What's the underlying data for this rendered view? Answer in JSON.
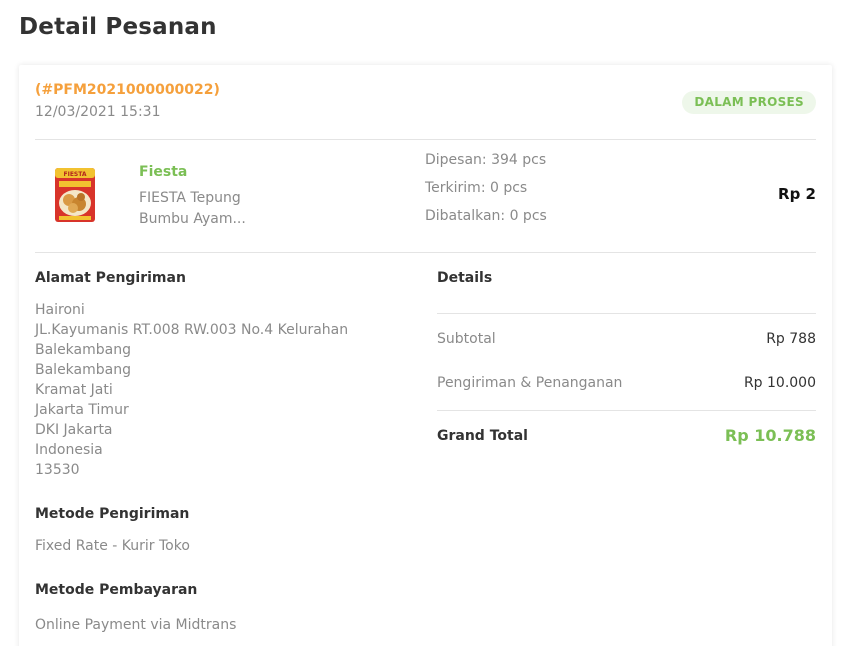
{
  "page": {
    "title": "Detail Pesanan"
  },
  "order": {
    "id": "(#PFM2021000000022)",
    "date": "12/03/2021 15:31",
    "status": "DALAM PROSES"
  },
  "product": {
    "brand": "Fiesta",
    "name_line1": "FIESTA Tepung",
    "name_line2": "Bumbu Ayam...",
    "image_icon": "product-package-icon",
    "ordered": "Dipesan: 394 pcs",
    "shipped": "Terkirim: 0 pcs",
    "cancelled": "Dibatalkan: 0 pcs",
    "price": "Rp 2"
  },
  "shipping_address": {
    "heading": "Alamat Pengiriman",
    "lines": [
      "Haironi",
      "JL.Kayumanis RT.008 RW.003 No.4 Kelurahan",
      "Balekambang",
      "Balekambang",
      "Kramat Jati",
      "Jakarta Timur",
      "DKI Jakarta",
      "Indonesia",
      "13530"
    ]
  },
  "shipping_method": {
    "heading": "Metode Pengiriman",
    "value": "Fixed Rate - Kurir Toko"
  },
  "payment_method": {
    "heading": "Metode Pembayaran",
    "value": "Online Payment via Midtrans"
  },
  "details": {
    "heading": "Details",
    "subtotal_label": "Subtotal",
    "subtotal_value": "Rp 788",
    "shipping_label": "Pengiriman & Penanganan",
    "shipping_value": "Rp 10.000",
    "grand_total_label": "Grand Total",
    "grand_total_value": "Rp 10.788"
  },
  "colors": {
    "accent_green": "#7bbf55",
    "order_orange": "#f5a03c",
    "muted_text": "#8a8a8a"
  }
}
